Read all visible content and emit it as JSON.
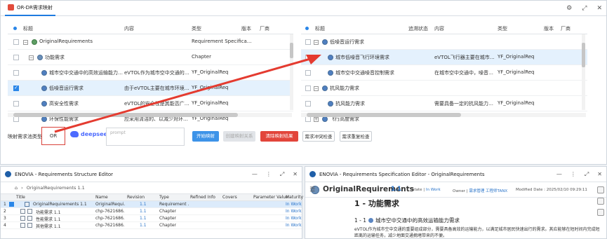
{
  "top_tab": {
    "title": "OR-DR需求映射"
  },
  "window_controls": [
    "⚙",
    "⤢",
    "✕"
  ],
  "left_tree": {
    "headers": {
      "title": "标题",
      "content": "内容",
      "type": "类型",
      "version": "版本",
      "vendor": "厂商"
    },
    "rows": [
      {
        "title": "OriginalRequirements",
        "content": "",
        "type": "Requirement Specifica...",
        "checked": false,
        "selected": false
      },
      {
        "title": "功能需求",
        "content": "",
        "type": "Chapter",
        "checked": false,
        "selected": false
      },
      {
        "title": "城市空中交通中的高效运输能力需求",
        "content": "eVTOL作为城市空中交通的重...",
        "type": "YF_OriginalReq",
        "checked": false,
        "selected": false
      },
      {
        "title": "低噪音运行需求",
        "content": "由于eVTOL主要在城市环境中...",
        "type": "YF_OriginalReq",
        "checked": true,
        "selected": true
      },
      {
        "title": "高安全性需求",
        "content": "eVTOL的安全性是其能否广泛...",
        "type": "YF_OriginalReq",
        "checked": false,
        "selected": false
      },
      {
        "title": "环保性能需求",
        "content": "应采用清洁的、以减少对环境...",
        "type": "YF_OriginalReq",
        "checked": false,
        "selected": false
      }
    ]
  },
  "right_tree": {
    "headers": {
      "title": "标题",
      "trace_status": "追溯状态",
      "content": "内容",
      "type": "类型",
      "version": "版本",
      "vendor": "厂商"
    },
    "rows": [
      {
        "title": "低噪音运行需求",
        "content": "",
        "type": ""
      },
      {
        "title": "城市低噪音飞行环境需求",
        "content": "eVTOL飞行器主要在城市环...",
        "type": "YF_OriginalReq"
      },
      {
        "title": "城市空中交通噪音控制需求",
        "content": "在城市空中交通中，噪音控制...",
        "type": "YF_OriginalReq"
      },
      {
        "title": "抗风能力需求",
        "content": "",
        "type": ""
      },
      {
        "title": "抗风能力需求",
        "content": "需要具备一定的抗风能力，以...",
        "type": "YF_OriginalReq"
      },
      {
        "title": "飞行高度需求",
        "content": "",
        "type": ""
      }
    ]
  },
  "controls": {
    "map_type_label": "映射需求池类型:",
    "map_type_value": "OR",
    "ai_brand": "deepseek",
    "prompt_placeholder": "prompt",
    "btn_start": "开始映射",
    "btn_create": "创建映射关系",
    "btn_clear": "清除映射结果",
    "btn_conflict": "需求冲突检查",
    "btn_duplicate": "需求重复检查"
  },
  "structure_editor": {
    "title": "ENOVIA - Requirements Structure Editor",
    "breadcrumb": "OriginalRequirements 1.1",
    "columns": [
      "Title",
      "Name",
      "Revision",
      "Type",
      "Refined Info",
      "Covers",
      "Parameter Value",
      "Maturity"
    ],
    "rows": [
      {
        "num": "1",
        "title": "OriginalRequirements 1.1",
        "name": "OriginalRequi...",
        "revision": "1.1",
        "type": "Requirement ...",
        "maturity": "In Work",
        "selected": true
      },
      {
        "num": "2",
        "title": "功能需求 1.1",
        "name": "chp-7621686...",
        "revision": "1.1",
        "type": "Chapter",
        "maturity": "In Work",
        "selected": false
      },
      {
        "num": "3",
        "title": "性能需求 1.1",
        "name": "chp-7621686...",
        "revision": "1.1",
        "type": "Chapter",
        "maturity": "In Work",
        "selected": false
      },
      {
        "num": "4",
        "title": "其他需求 1.1",
        "name": "chp-7621686...",
        "revision": "1.1",
        "type": "Chapter",
        "maturity": "In Work",
        "selected": false
      }
    ]
  },
  "spec_editor": {
    "title": "ENOVIA - Requirements Specification Editor - OriginalRequirements",
    "doc_title": "OriginalRequirements",
    "doc_rev": "1.1",
    "state_label": "State |",
    "state_value": "In Work",
    "owner_label": "Owner |",
    "owner_value": "需求管理 工程师TANX",
    "modified_label": "Modified Date :",
    "modified_value": "2025/02/10 09:29:11",
    "section_heading": "1 - 功能需求",
    "sub_heading_num": "1 - 1",
    "sub_heading": "城市空中交通中的高效运输能力需求",
    "paragraph": "eVTOL作为城市空中交通的重要组成部分，需要具备高效的运输能力，以满足城市居民快速出行的需求。其应能够在短时间内完成短距离的运输任务，减少地面交通拥堵带来的不便。"
  }
}
